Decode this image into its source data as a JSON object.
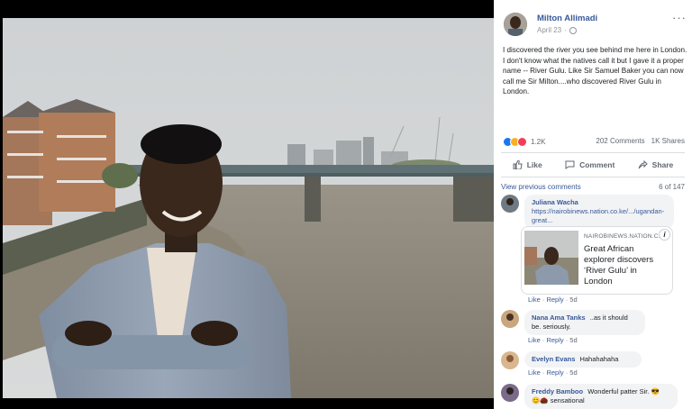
{
  "post": {
    "author": "Milton Allimadi",
    "date": "April 23",
    "text": "I discovered the river you see behind me here in London. I don't know what the natives call it but I gave it a proper name -- River Gulu. Like Sir Samuel Baker you can now call me Sir Milton....who discovered River Gulu in London.",
    "more_icon": "···",
    "reaction_count": "1.2K",
    "comments_count": "202 Comments",
    "shares_count": "1K Shares"
  },
  "actions": {
    "like": "Like",
    "comment": "Comment",
    "share": "Share"
  },
  "comments_header": {
    "view_previous": "View previous comments",
    "page_count": "6 of 147"
  },
  "comments": [
    {
      "name": "Juliana Wacha",
      "text": "https://nairobinews.nation.co.ke/.../ugandan-great...",
      "like": "Like",
      "reply": "Reply",
      "time": "5d"
    },
    {
      "name": "Nana Ama Tanks",
      "text": "..as it should be. seriously.",
      "like": "Like",
      "reply": "Reply",
      "time": "5d"
    },
    {
      "name": "Evelyn Evans",
      "text": "Hahahahaha",
      "like": "Like",
      "reply": "Reply",
      "time": "5d"
    },
    {
      "name": "Freddy Bamboo",
      "text": "Wonderful patter Sir. 😎",
      "text2": "😊🌰 sensational"
    }
  ],
  "link_card": {
    "domain": "NAIROBINEWS.NATION.C...",
    "title": "Great African explorer discovers ‘River Gulu’ in London",
    "info": "i"
  },
  "colors": {
    "link_blue": "#385898",
    "like_blue": "#1877f2",
    "love_red": "#f33e58",
    "haha_yellow": "#f7b125"
  }
}
